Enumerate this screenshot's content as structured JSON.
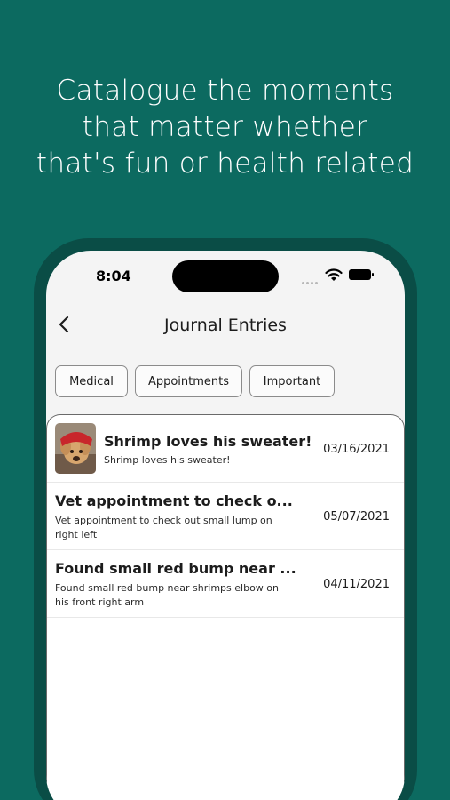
{
  "headline": {
    "line1": "Catalogue the moments",
    "line2": "that matter whether",
    "line3": "that's fun or health related"
  },
  "status_bar": {
    "time": "8:04"
  },
  "nav": {
    "title": "Journal Entries",
    "back_icon": "chevron-left-icon"
  },
  "filters": [
    "Medical",
    "Appointments",
    "Important"
  ],
  "entries": [
    {
      "title": "Shrimp loves his sweater!",
      "body": "Shrimp loves his sweater!",
      "date": "03/16/2021",
      "has_photo": true
    },
    {
      "title": "Vet appointment to check o...",
      "body": "Vet appointment to check out small lump on right left",
      "date": "05/07/2021",
      "has_photo": false
    },
    {
      "title": "Found small red bump near ...",
      "body": "Found small red bump near shrimps elbow on his front right arm",
      "date": "04/11/2021",
      "has_photo": false
    }
  ],
  "colors": {
    "background": "#0c6a60",
    "phone_frame": "#0a4d46",
    "screen": "#f4f4f4"
  }
}
